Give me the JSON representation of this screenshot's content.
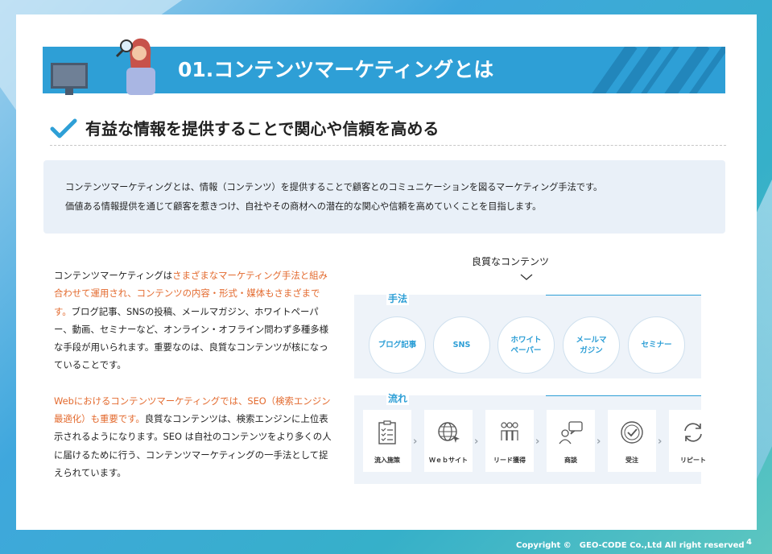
{
  "header": {
    "title": "01.コンテンツマーケティングとは"
  },
  "subheading": "有益な情報を提供することで関心や信頼を高める",
  "intro": {
    "line1": "コンテンツマーケティングとは、情報（コンテンツ）を提供することで顧客とのコミュニケーションを図るマーケティング手法です。",
    "line2": "価値ある情報提供を通じて顧客を惹きつけ、自社やその商材への潜在的な関心や信頼を高めていくことを目指します。"
  },
  "body": {
    "p1_a": "コンテンツマーケティングは",
    "p1_hl": "さまざまなマーケティング手法と組み合わせて運用され、コンテンツの内容・形式・媒体もさまざまです。",
    "p1_b": "ブログ記事、SNSの投稿、メールマガジン、ホワイトペーパー、動画、セミナーなど、オンライン・オフライン問わず多種多様な手段が用いられます。重要なのは、良質なコンテンツが核になっていることです。",
    "p2_hl": "Webにおけるコンテンツマーケティングでは、SEO（検索エンジン最適化）も重要です。",
    "p2_b": "良質なコンテンツは、検索エンジンに上位表示されるようになります。SEO は自社のコンテンツをより多くの人に届けるために行う、コンテンツマーケティングの一手法として捉えられています。"
  },
  "diagram": {
    "title": "良質なコンテンツ",
    "methods_title": "手法",
    "methods": [
      "ブログ記事",
      "SNS",
      "ホワイト\nペーパー",
      "メールマ\nガジン",
      "セミナー"
    ],
    "flow_title": "流れ",
    "flow": [
      "流入施策",
      "Ｗｅｂサイト",
      "リード獲得",
      "商談",
      "受注",
      "リピート"
    ]
  },
  "footer": {
    "copyright": "Copyright ©　GEO-CODE Co.,Ltd All right reserved",
    "page": "4"
  }
}
